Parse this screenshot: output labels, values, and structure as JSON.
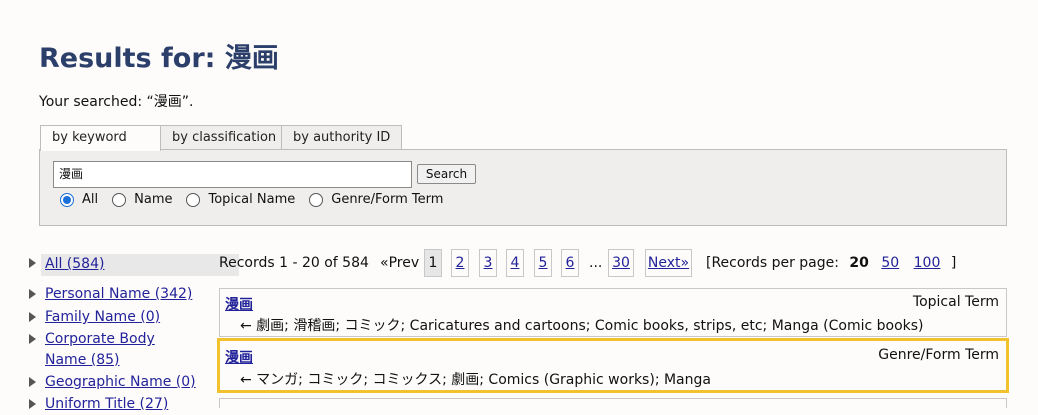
{
  "heading": "Results for: 漫画",
  "searched_text": "Your searched: “漫画”.",
  "tabs": [
    {
      "label": "by keyword"
    },
    {
      "label": "by classification"
    },
    {
      "label": "by authority ID"
    }
  ],
  "search": {
    "value": "漫画",
    "button": "Search"
  },
  "radios": [
    {
      "label": "All",
      "checked": true
    },
    {
      "label": "Name",
      "checked": false
    },
    {
      "label": "Topical Name",
      "checked": false
    },
    {
      "label": "Genre/Form Term",
      "checked": false
    }
  ],
  "sidebar": {
    "items": [
      {
        "label": "All (584)"
      },
      {
        "label": "Personal Name (342)"
      },
      {
        "label": "Family Name (0)"
      },
      {
        "label": "Corporate Body"
      },
      {
        "label": "Name (85)"
      },
      {
        "label": "Geographic Name (0)"
      },
      {
        "label": "Uniform Title (27)"
      }
    ]
  },
  "pager": {
    "records": "Records 1 - 20 of 584",
    "prev": "«Prev",
    "pages": [
      "1",
      "2",
      "3",
      "4",
      "5",
      "6"
    ],
    "dots": "...",
    "last": "30",
    "next": "Next»",
    "per_page_label": "[Records per page:",
    "per_page_current": "20",
    "per_page_options": [
      "50",
      "100"
    ],
    "close_bracket": "]"
  },
  "results": [
    {
      "heading": "漫画",
      "type": "Topical Term",
      "refs": "← 劇画; 滑稽画; コミック; Caricatures and cartoons; Comic books, strips, etc; Manga (Comic books)"
    },
    {
      "heading": "漫画",
      "type": "Genre/Form Term",
      "refs": "← マンガ; コミック; コミックス; 劇画; Comics (Graphic works); Manga"
    }
  ],
  "colors": {
    "title": "#2c3f6b",
    "link": "#22229a",
    "highlight": "#f2c12e"
  }
}
